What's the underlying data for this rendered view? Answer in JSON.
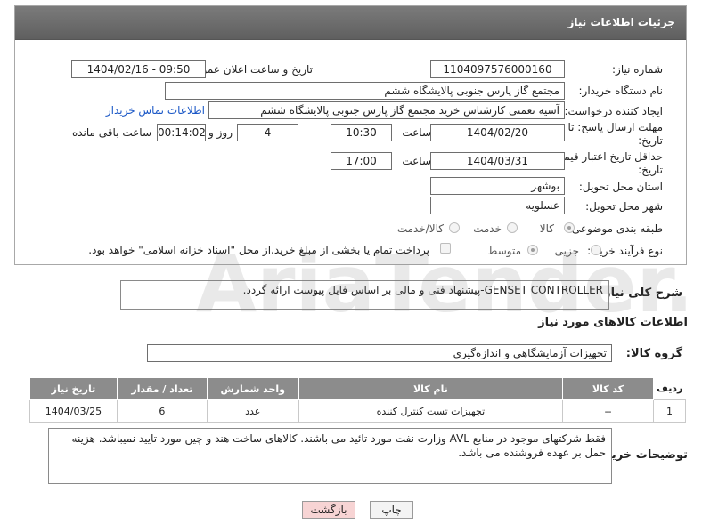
{
  "panel": {
    "title": "جزئیات اطلاعات نیاز"
  },
  "fields": {
    "need_number_label": "شماره نیاز:",
    "need_number": "1104097576000160",
    "announce_label": "تاریخ و ساعت اعلان عمومی:",
    "announce_value": "1404/02/16 - 09:50",
    "buyer_org_label": "نام دستگاه خریدار:",
    "buyer_org": "مجتمع گاز پارس جنوبی  پالایشگاه ششم",
    "creator_label": "ایجاد کننده درخواست:",
    "creator": "آسیه نعمتی کارشناس خرید مجتمع گاز پارس جنوبی  پالایشگاه ششم",
    "contact_link": "اطلاعات تماس خریدار",
    "deadline_label": "مهلت ارسال پاسخ: تا تاریخ:",
    "deadline_date": "1404/02/20",
    "time_label": "ساعت",
    "deadline_time": "10:30",
    "days_value": "4",
    "days_label": "روز و",
    "remaining_time": "00:14:02",
    "remaining_label": "ساعت باقی مانده",
    "validity_label": "حداقل تاریخ اعتبار قیمت: تا تاریخ:",
    "validity_date": "1404/03/31",
    "validity_time": "17:00",
    "province_label": "استان محل تحویل:",
    "province": "بوشهر",
    "city_label": "شهر محل تحویل:",
    "city": "عسلویه",
    "category_label": "طبقه بندی موضوعی:",
    "category_options": [
      "کالا",
      "خدمت",
      "کالا/خدمت"
    ],
    "category_selected": "کالا",
    "process_label": "نوع فرآیند خرید :",
    "process_options": [
      "جزیی",
      "متوسط"
    ],
    "process_selected": "متوسط",
    "payment_note": "پرداخت تمام یا بخشی از مبلغ خرید،از محل \"اسناد خزانه اسلامی\" خواهد بود."
  },
  "description": {
    "label": "شرح کلی نیاز:",
    "text": "GENSET CONTROLLER-پیشنهاد فنی و مالی بر اساس فایل پیوست ارائه گردد."
  },
  "goods_info": {
    "title": "اطلاعات کالاهای مورد نیاز",
    "group_label": "گروه کالا:",
    "group_value": "تجهیزات آزمایشگاهی و اندازه‌گیری"
  },
  "table": {
    "headers": [
      "ردیف",
      "کد کالا",
      "نام کالا",
      "واحد شمارش",
      "تعداد / مقدار",
      "تاریخ نیاز"
    ],
    "rows": [
      [
        "1",
        "--",
        "تجهیزات تست کنترل کننده",
        "عدد",
        "6",
        "1404/03/25"
      ]
    ]
  },
  "buyer_notes": {
    "label": "توضیحات خریدار:",
    "text": "فقط شرکتهای موجود در منابع AVL وزارت نفت مورد تائید می باشند. کالاهای ساخت هند و چین مورد تایید نمیباشد. هزینه حمل بر عهده فروشنده می باشد."
  },
  "buttons": {
    "print": "چاپ",
    "back": "بازگشت"
  },
  "watermark": {
    "text": "AriaTender.net"
  },
  "colors": {
    "header": "#6e6e6e",
    "link": "#1a57c6",
    "back_button": "#f7d4d4",
    "table_header": "#8c8c8c"
  }
}
